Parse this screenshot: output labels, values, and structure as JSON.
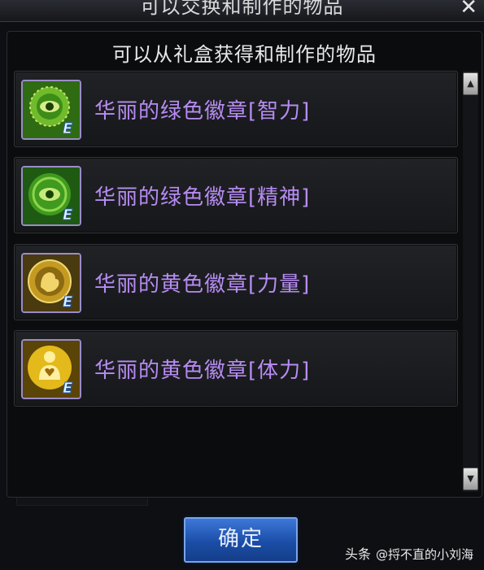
{
  "window": {
    "title": "可以交换和制作的物品",
    "close_symbol": "✕"
  },
  "panel": {
    "title": "可以从礼盒获得和制作的物品",
    "items": [
      {
        "label": "华丽的绿色徽章[智力]",
        "icon": "green-eye-emblem-icon",
        "badge": "E"
      },
      {
        "label": "华丽的绿色徽章[精神]",
        "icon": "green-eye-emblem-icon",
        "badge": "E"
      },
      {
        "label": "华丽的黄色徽章[力量]",
        "icon": "yellow-arm-emblem-icon",
        "badge": "E"
      },
      {
        "label": "华丽的黄色徽章[体力]",
        "icon": "yellow-heart-emblem-icon",
        "badge": "E"
      }
    ]
  },
  "scrollbar": {
    "up_symbol": "▲",
    "down_symbol": "▼"
  },
  "confirm_button": {
    "label": "确定"
  },
  "watermark": {
    "source": "头条",
    "author": "@捋不直的小刘海"
  },
  "colors": {
    "item_label": "#b78cf2",
    "icon_border": "#9a8cc8",
    "green_icon": "#4fae25",
    "yellow_icon": "#d8b21e",
    "button_blue": "#1b4ea8"
  }
}
